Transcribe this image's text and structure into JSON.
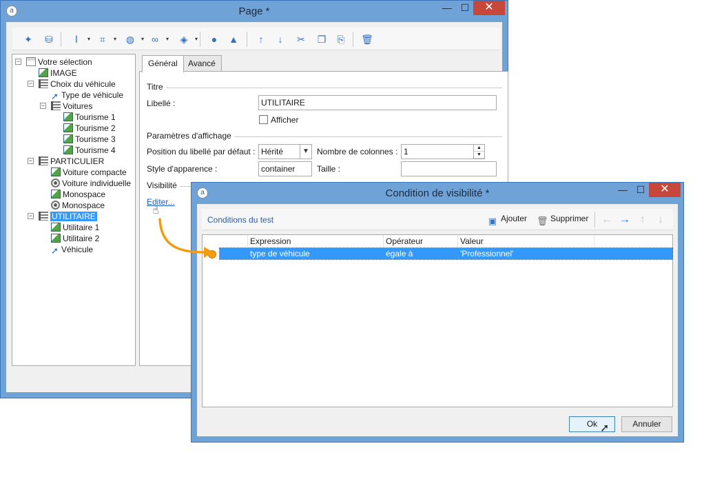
{
  "page_window": {
    "title": "Page *",
    "app_icon": "adobe-icon",
    "controls": {
      "minimize": "—",
      "maximize": "☐",
      "close": "✕"
    },
    "toolbar": [
      {
        "name": "wand-icon",
        "glyph": "✦"
      },
      {
        "name": "database-icon",
        "glyph": "⛁"
      },
      {
        "name": "text-cursor-icon",
        "glyph": "Ⅰ",
        "caret": "▾"
      },
      {
        "name": "form-control-icon",
        "glyph": "⌗",
        "caret": "▾"
      },
      {
        "name": "globe-icon",
        "glyph": "◍",
        "caret": "▾"
      },
      {
        "name": "link-icon",
        "glyph": "∞",
        "caret": "▾"
      },
      {
        "name": "layers-icon",
        "glyph": "◈",
        "caret": "▾"
      },
      {
        "name": "person-icon",
        "glyph": "●"
      },
      {
        "name": "shapes-icon",
        "glyph": "▲"
      },
      {
        "name": "arrow-up-icon",
        "glyph": "↑"
      },
      {
        "name": "arrow-down-icon",
        "glyph": "↓"
      },
      {
        "name": "scissors-icon",
        "glyph": "✂"
      },
      {
        "name": "copy-icon",
        "glyph": "❐"
      },
      {
        "name": "paste-icon",
        "glyph": "⎘"
      },
      {
        "name": "trash-icon",
        "glyph": "🗑"
      }
    ],
    "tree": [
      {
        "label": "Votre sélection",
        "icon": "page",
        "depth": 0,
        "exp": "⊟"
      },
      {
        "label": "IMAGE",
        "icon": "pic",
        "depth": 1
      },
      {
        "label": "Choix du véhicule",
        "icon": "list",
        "depth": 1,
        "exp": "⊟"
      },
      {
        "label": "Type de véhicule",
        "icon": "cursor",
        "depth": 2
      },
      {
        "label": "Voitures",
        "icon": "list",
        "depth": 2,
        "exp": "⊟"
      },
      {
        "label": "Tourisme 1",
        "icon": "pic",
        "depth": 3
      },
      {
        "label": "Tourisme 2",
        "icon": "pic",
        "depth": 3
      },
      {
        "label": "Tourisme 3",
        "icon": "pic",
        "depth": 3
      },
      {
        "label": "Tourisme 4",
        "icon": "pic",
        "depth": 3
      },
      {
        "label": "PARTICULIER",
        "icon": "list",
        "depth": 1,
        "exp": "⊟"
      },
      {
        "label": "Voiture compacte",
        "icon": "pic",
        "depth": 2
      },
      {
        "label": "Voiture individuelle",
        "icon": "radio",
        "depth": 2
      },
      {
        "label": "Monospace",
        "icon": "pic",
        "depth": 2
      },
      {
        "label": "Monospace",
        "icon": "radio",
        "depth": 2
      },
      {
        "label": "UTILITAIRE",
        "icon": "list",
        "depth": 1,
        "exp": "⊟",
        "selected": true
      },
      {
        "label": "Utilitaire 1",
        "icon": "pic",
        "depth": 2
      },
      {
        "label": "Utilitaire 2",
        "icon": "pic",
        "depth": 2
      },
      {
        "label": "Véhicule",
        "icon": "cursor",
        "depth": 2
      }
    ],
    "tabs": [
      "Général",
      "Avancé"
    ],
    "form": {
      "group_titre": "Titre",
      "libelle_label": "Libellé :",
      "libelle_value": "UTILITAIRE",
      "afficher_label": "Afficher",
      "group_params": "Paramètres d'affichage",
      "position_label": "Position du libellé par défaut :",
      "position_value": "Hérité",
      "colonnes_label": "Nombre de colonnes :",
      "colonnes_value": "1",
      "style_label": "Style d'apparence :",
      "style_value": "container",
      "taille_label": "Taille :",
      "taille_value": "",
      "group_visibilite": "Visibilité",
      "editer_link": "Editer..."
    }
  },
  "dialog": {
    "title": "Condition de visibilité *",
    "controls": {
      "minimize": "—",
      "maximize": "☐",
      "close": "✕"
    },
    "caption": "Conditions du test",
    "add_label": "Ajouter",
    "delete_label": "Supprimer",
    "columns": [
      "Expression",
      "Opérateur",
      "Valeur"
    ],
    "rows": [
      {
        "expression": "type de véhicule",
        "operateur": "égale à",
        "valeur": "'Professionnel'"
      }
    ],
    "ok_label": "Ok",
    "cancel_label": "Annuler",
    "colors": {
      "selection": "#3399ff",
      "condition_dot": "#f39c12",
      "callout_arrow": "#f39c12"
    }
  }
}
